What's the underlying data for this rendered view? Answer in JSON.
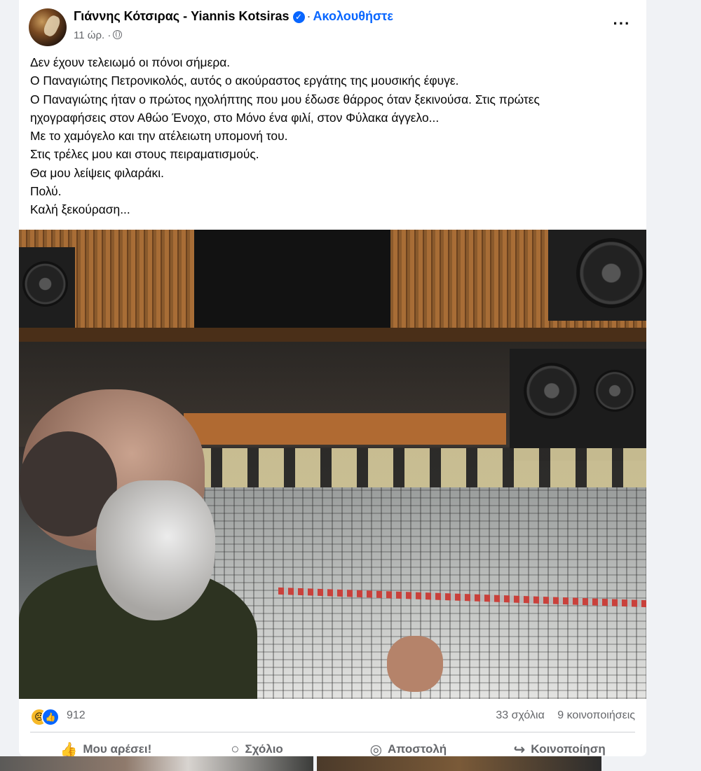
{
  "post": {
    "author": "Γιάννης Κότσιρας - Yiannis Kotsiras",
    "follow_label": "Ακολουθήστε",
    "time": "11 ώρ.",
    "text_lines": [
      "Δεν έχουν τελειωμό οι πόνοι σήμερα.",
      "Ο Παναγιώτης Πετρονικολός, αυτός ο ακούραστος εργάτης της μουσικής έφυγε.",
      "Ο Παναγιώτης ήταν ο πρώτος ηχολήπτης που μου έδωσε θάρρος όταν ξεκινούσα. Στις πρώτες",
      "ηχογραφήσεις στον Αθώο Ένοχο, στο Μόνο ένα φιλί, στον Φύλακα άγγελο...",
      "Με το χαμόγελο και την ατέλειωτη υπομονή του.",
      "Στις τρέλες μου και στους πειραματισμούς.",
      "Θα μου λείψεις φιλαράκι.",
      "Πολύ.",
      "Καλή ξεκούραση..."
    ],
    "reactions_count": "912",
    "comments": "33 σχόλια",
    "shares": "9 κοινοποιήσεις"
  },
  "actions": {
    "like": "Μου αρέσει!",
    "comment": "Σχόλιο",
    "send": "Αποστολή",
    "share": "Κοινοποίηση"
  },
  "icons": {
    "verified": "verified-badge-icon",
    "privacy": "globe-icon",
    "more": "more-options-icon",
    "reaction_sad": "sad-reaction-icon",
    "reaction_like": "like-reaction-icon"
  },
  "colors": {
    "accent": "#0866ff",
    "secondary_text": "#65676b",
    "background": "#f0f2f5"
  }
}
